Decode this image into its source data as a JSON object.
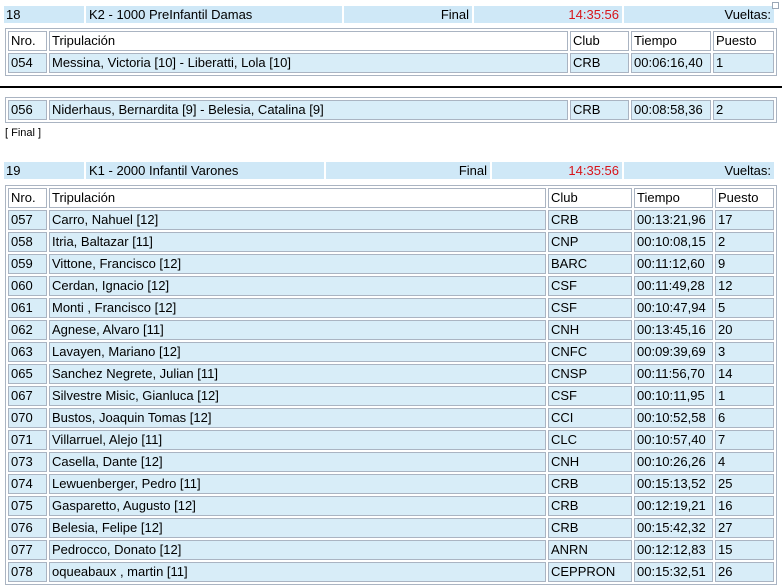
{
  "race1": {
    "number": "18",
    "title": "K2 - 1000 PreInfantil Damas",
    "stage": "Final",
    "time": "14:35:56",
    "laps_label": "Vueltas:"
  },
  "columns": {
    "nro": "Nro.",
    "crew": "Tripulación",
    "club": "Club",
    "time": "Tiempo",
    "place": "Puesto"
  },
  "race1_rows": [
    {
      "nro": "054",
      "crew": "Messina, Victoria [10] - Liberatti, Lola [10]",
      "club": "CRB",
      "time": "00:06:16,40",
      "place": "1"
    }
  ],
  "race1b_rows": [
    {
      "nro": "056",
      "crew": "Niderhaus, Bernardita [9] - Belesia, Catalina [9]",
      "club": "CRB",
      "time": "00:08:58,36",
      "place": "2"
    }
  ],
  "final_note": "[ Final ]",
  "race2": {
    "number": "19",
    "title": "K1 - 2000 Infantil Varones",
    "stage": "Final",
    "time": "14:35:56",
    "laps_label": "Vueltas:"
  },
  "race2_rows": [
    {
      "nro": "057",
      "crew": "Carro, Nahuel [12]",
      "club": "CRB",
      "time": "00:13:21,96",
      "place": "17"
    },
    {
      "nro": "058",
      "crew": "Itria, Baltazar [11]",
      "club": "CNP",
      "time": "00:10:08,15",
      "place": "2"
    },
    {
      "nro": "059",
      "crew": "Vittone, Francisco [12]",
      "club": "BARC",
      "time": "00:11:12,60",
      "place": "9"
    },
    {
      "nro": "060",
      "crew": "Cerdan, Ignacio [12]",
      "club": "CSF",
      "time": "00:11:49,28",
      "place": "12"
    },
    {
      "nro": "061",
      "crew": "Monti , Francisco [12]",
      "club": "CSF",
      "time": "00:10:47,94",
      "place": "5"
    },
    {
      "nro": "062",
      "crew": "Agnese, Alvaro [11]",
      "club": "CNH",
      "time": "00:13:45,16",
      "place": "20"
    },
    {
      "nro": "063",
      "crew": "Lavayen, Mariano [12]",
      "club": "CNFC",
      "time": "00:09:39,69",
      "place": "3"
    },
    {
      "nro": "065",
      "crew": "Sanchez Negrete, Julian [11]",
      "club": "CNSP",
      "time": "00:11:56,70",
      "place": "14"
    },
    {
      "nro": "067",
      "crew": "Silvestre Misic, Gianluca [12]",
      "club": "CSF",
      "time": "00:10:11,95",
      "place": "1"
    },
    {
      "nro": "070",
      "crew": "Bustos, Joaquin Tomas [12]",
      "club": "CCI",
      "time": "00:10:52,58",
      "place": "6"
    },
    {
      "nro": "071",
      "crew": "Villarruel, Alejo [11]",
      "club": "CLC",
      "time": "00:10:57,40",
      "place": "7"
    },
    {
      "nro": "073",
      "crew": "Casella, Dante [12]",
      "club": "CNH",
      "time": "00:10:26,26",
      "place": "4"
    },
    {
      "nro": "074",
      "crew": "Lewuenberger, Pedro [11]",
      "club": "CRB",
      "time": "00:15:13,52",
      "place": "25"
    },
    {
      "nro": "075",
      "crew": "Gasparetto, Augusto [12]",
      "club": "CRB",
      "time": "00:12:19,21",
      "place": "16"
    },
    {
      "nro": "076",
      "crew": "Belesia, Felipe [12]",
      "club": "CRB",
      "time": "00:15:42,32",
      "place": "27"
    },
    {
      "nro": "077",
      "crew": "Pedrocco, Donato [12]",
      "club": "ANRN",
      "time": "00:12:12,83",
      "place": "15"
    },
    {
      "nro": "078",
      "crew": "oqueabaux , martin [11]",
      "club": "CEPPRON",
      "time": "00:15:32,51",
      "place": "26"
    }
  ]
}
